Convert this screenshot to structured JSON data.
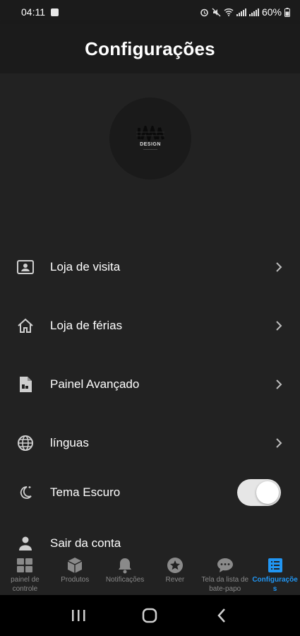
{
  "status_bar": {
    "time": "04:11",
    "battery": "60%"
  },
  "header": {
    "title": "Configurações"
  },
  "profile": {
    "logo_text": "DESIGN"
  },
  "menu": {
    "items": [
      {
        "label": "Loja de visita",
        "icon": "contact-card-icon"
      },
      {
        "label": "Loja de férias",
        "icon": "home-icon"
      },
      {
        "label": "Painel Avançado",
        "icon": "document-icon"
      },
      {
        "label": "línguas",
        "icon": "globe-icon"
      },
      {
        "label": "Tema Escuro",
        "icon": "moon-icon",
        "toggle": true
      },
      {
        "label": "Sair da conta",
        "icon": "person-icon"
      }
    ]
  },
  "bottom_nav": {
    "items": [
      {
        "label": "painel de controle",
        "icon": "dashboard-icon"
      },
      {
        "label": "Produtos",
        "icon": "box-icon"
      },
      {
        "label": "Notificações",
        "icon": "bell-icon"
      },
      {
        "label": "Rever",
        "icon": "star-icon"
      },
      {
        "label": "Tela da lista de bate-papo",
        "icon": "chat-icon"
      },
      {
        "label": "Configuraçõe s",
        "icon": "list-icon",
        "active": true
      }
    ]
  },
  "colors": {
    "background": "#222222",
    "header": "#1b1b1b",
    "accent": "#2196f3",
    "inactive": "#8a8a8a"
  }
}
